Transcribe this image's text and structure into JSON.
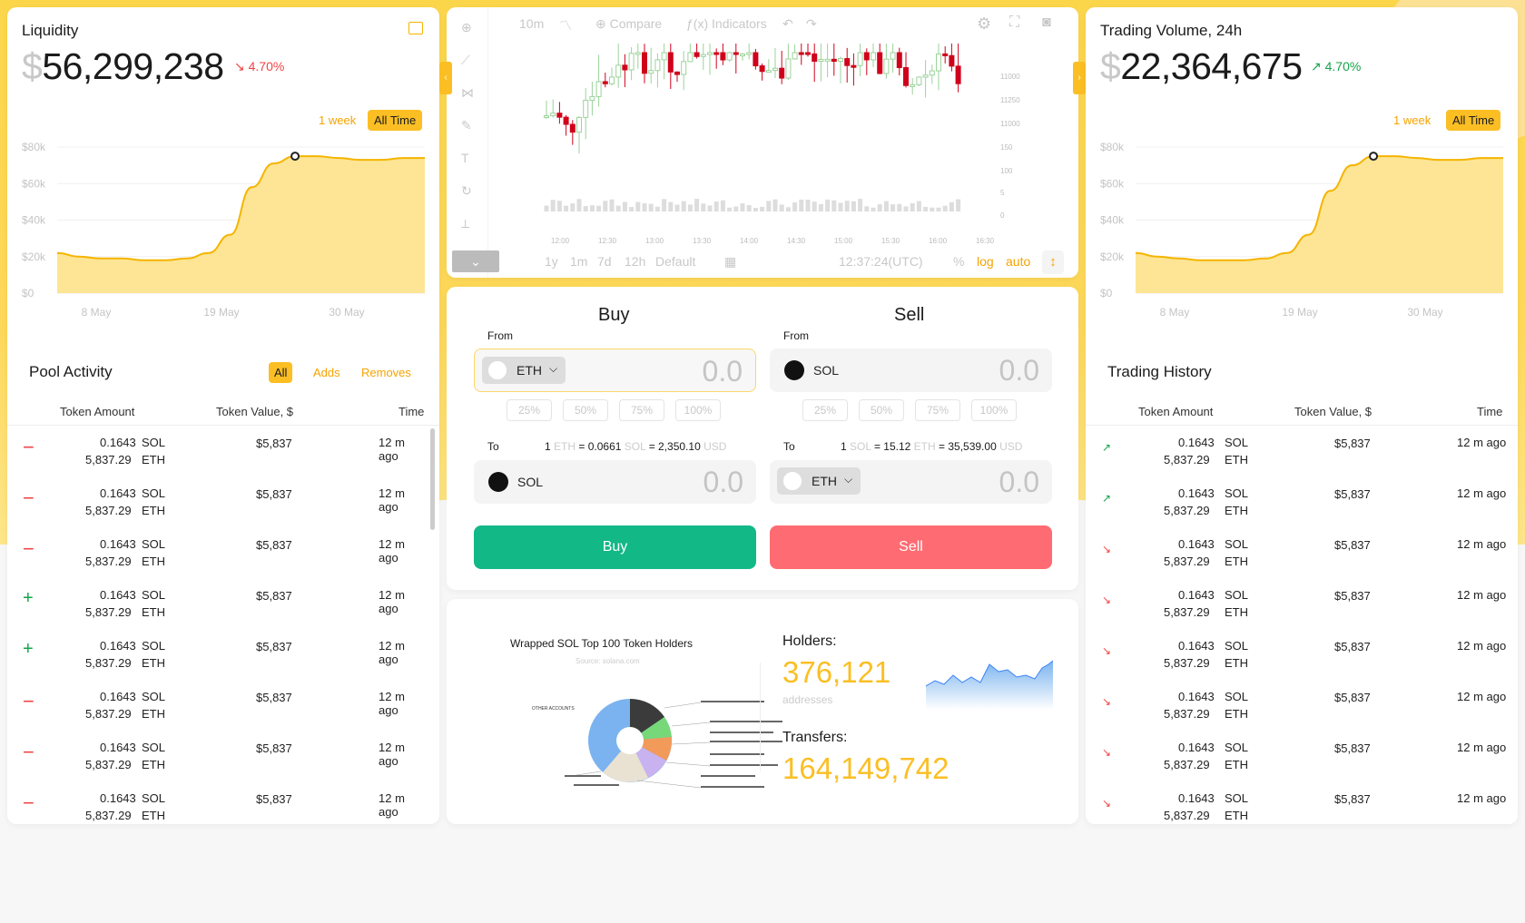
{
  "liquidity": {
    "title": "Liquidity",
    "currency": "$",
    "value": "56,299,238",
    "change": "4.70%",
    "toggle_week": "1 week",
    "toggle_all": "All Time",
    "y_ticks": [
      "$80k",
      "$60k",
      "$40k",
      "$20k",
      "$0"
    ],
    "x_ticks": [
      "8 May",
      "19 May",
      "30 May"
    ]
  },
  "volume": {
    "title": "Trading Volume, 24h",
    "currency": "$",
    "value": "22,364,675",
    "change": "4.70%",
    "toggle_week": "1 week",
    "toggle_all": "All Time",
    "y_ticks": [
      "$80k",
      "$60k",
      "$40k",
      "$20k",
      "$0"
    ],
    "x_ticks": [
      "8 May",
      "19 May",
      "30 May"
    ]
  },
  "chart_data": [
    {
      "type": "area",
      "title": "",
      "series": [
        {
          "name": "",
          "values": [
            22,
            20,
            19,
            19,
            18,
            18,
            19,
            22,
            32,
            58,
            71,
            75,
            75,
            74,
            73,
            73,
            74,
            74
          ]
        }
      ],
      "ylim": [
        0,
        80
      ],
      "ylabel": "",
      "xlabel": ""
    },
    {
      "type": "area",
      "title": "",
      "series": [
        {
          "name": "",
          "values": [
            22,
            20,
            19,
            18,
            18,
            18,
            19,
            22,
            32,
            56,
            70,
            75,
            75,
            74,
            73,
            73,
            74,
            74
          ]
        }
      ],
      "ylim": [
        0,
        80
      ],
      "ylabel": "",
      "xlabel": ""
    }
  ],
  "pool": {
    "title": "Pool Activity",
    "tabs": [
      "All",
      "Adds",
      "Removes"
    ],
    "headers": [
      "Token Amount",
      "Token Value, $",
      "Time"
    ],
    "rows": [
      {
        "sign": "−",
        "amt1": "0.1643",
        "sym1": "SOL",
        "amt2": "5,837.29",
        "sym2": "ETH",
        "value": "$5,837",
        "time": "12 m ago"
      },
      {
        "sign": "−",
        "amt1": "0.1643",
        "sym1": "SOL",
        "amt2": "5,837.29",
        "sym2": "ETH",
        "value": "$5,837",
        "time": "12 m ago"
      },
      {
        "sign": "−",
        "amt1": "0.1643",
        "sym1": "SOL",
        "amt2": "5,837.29",
        "sym2": "ETH",
        "value": "$5,837",
        "time": "12 m ago"
      },
      {
        "sign": "+",
        "amt1": "0.1643",
        "sym1": "SOL",
        "amt2": "5,837.29",
        "sym2": "ETH",
        "value": "$5,837",
        "time": "12 m ago"
      },
      {
        "sign": "+",
        "amt1": "0.1643",
        "sym1": "SOL",
        "amt2": "5,837.29",
        "sym2": "ETH",
        "value": "$5,837",
        "time": "12 m ago"
      },
      {
        "sign": "−",
        "amt1": "0.1643",
        "sym1": "SOL",
        "amt2": "5,837.29",
        "sym2": "ETH",
        "value": "$5,837",
        "time": "12 m ago"
      },
      {
        "sign": "−",
        "amt1": "0.1643",
        "sym1": "SOL",
        "amt2": "5,837.29",
        "sym2": "ETH",
        "value": "$5,837",
        "time": "12 m ago"
      },
      {
        "sign": "−",
        "amt1": "0.1643",
        "sym1": "SOL",
        "amt2": "5,837.29",
        "sym2": "ETH",
        "value": "$5,837",
        "time": "12 m ago"
      }
    ]
  },
  "history": {
    "title": "Trading History",
    "headers": [
      "Token Amount",
      "Token Value, $",
      "Time"
    ],
    "rows": [
      {
        "dir": "up",
        "amt1": "0.1643",
        "sym1": "SOL",
        "amt2": "5,837.29",
        "sym2": "ETH",
        "value": "$5,837",
        "time": "12 m ago"
      },
      {
        "dir": "up",
        "amt1": "0.1643",
        "sym1": "SOL",
        "amt2": "5,837.29",
        "sym2": "ETH",
        "value": "$5,837",
        "time": "12 m ago"
      },
      {
        "dir": "down",
        "amt1": "0.1643",
        "sym1": "SOL",
        "amt2": "5,837.29",
        "sym2": "ETH",
        "value": "$5,837",
        "time": "12 m ago"
      },
      {
        "dir": "down",
        "amt1": "0.1643",
        "sym1": "SOL",
        "amt2": "5,837.29",
        "sym2": "ETH",
        "value": "$5,837",
        "time": "12 m ago"
      },
      {
        "dir": "down",
        "amt1": "0.1643",
        "sym1": "SOL",
        "amt2": "5,837.29",
        "sym2": "ETH",
        "value": "$5,837",
        "time": "12 m ago"
      },
      {
        "dir": "down",
        "amt1": "0.1643",
        "sym1": "SOL",
        "amt2": "5,837.29",
        "sym2": "ETH",
        "value": "$5,837",
        "time": "12 m ago"
      },
      {
        "dir": "down",
        "amt1": "0.1643",
        "sym1": "SOL",
        "amt2": "5,837.29",
        "sym2": "ETH",
        "value": "$5,837",
        "time": "12 m ago"
      },
      {
        "dir": "down",
        "amt1": "0.1643",
        "sym1": "SOL",
        "amt2": "5,837.29",
        "sym2": "ETH",
        "value": "$5,837",
        "time": "12 m ago"
      }
    ]
  },
  "tradingchart": {
    "interval": "10m",
    "compare": "Compare",
    "indicators": "Indicators",
    "ranges": [
      "1y",
      "1m",
      "7d",
      "12h",
      "Default"
    ],
    "clock": "12:37:24(UTC)",
    "pct": "%",
    "log": "log",
    "auto": "auto",
    "times": [
      "12:00",
      "12:30",
      "13:00",
      "13:30",
      "14:00",
      "14:30",
      "15:00",
      "15:30",
      "16:00",
      "16:30"
    ],
    "prices": [
      "11000",
      "11250",
      "11000",
      "150",
      "100",
      "5",
      "0"
    ]
  },
  "trade": {
    "buy_title": "Buy",
    "sell_title": "Sell",
    "from": "From",
    "to": "To",
    "zero": "0.0",
    "pcts": [
      "25%",
      "50%",
      "75%",
      "100%"
    ],
    "buy_from": "ETH",
    "buy_to": "SOL",
    "sell_from": "SOL",
    "sell_to": "ETH",
    "buy_rate": {
      "one": "1",
      "base": "ETH",
      "eq1": "= 0.0661",
      "quote": "SOL",
      "eq2": "= 2,350.10",
      "usd": "USD"
    },
    "sell_rate": {
      "one": "1",
      "base": "SOL",
      "eq1": "= 15.12",
      "quote": "ETH",
      "eq2": "= 35,539.00",
      "usd": "USD"
    },
    "buy_btn": "Buy",
    "sell_btn": "Sell",
    "buy_color": "#12b886",
    "sell_color": "#ff6b72"
  },
  "holders": {
    "pie_title": "Wrapped SOL Top 100 Token Holders",
    "pie_source": "Source: solana.com",
    "other_label": "OTHER ACCOUNTS",
    "holders_label": "Holders:",
    "holders_value": "376,121",
    "holders_unit": "addresses",
    "transfers_label": "Transfers:",
    "transfers_value": "164,149,742"
  }
}
